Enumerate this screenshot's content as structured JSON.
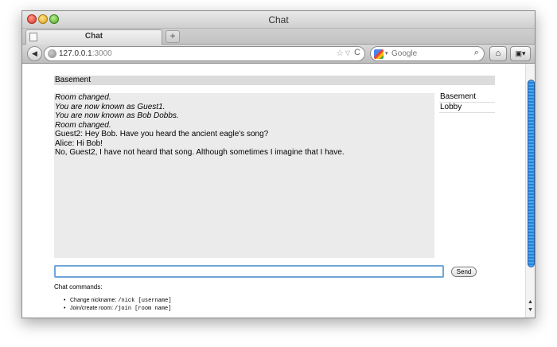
{
  "window": {
    "title": "Chat"
  },
  "tab": {
    "label": "Chat",
    "close": "×",
    "new_tab": "+"
  },
  "nav": {
    "back": "◀",
    "url_host": "127.0.0.1",
    "url_port": ":3000",
    "bookmark_star": "☆",
    "url_dropdown": "▽",
    "reload": "C",
    "search_placeholder": "Google",
    "search_dropdown": "▾",
    "search_glass": "⌕",
    "home": "⌂",
    "menu": "▣▾"
  },
  "page": {
    "room_header": "Basement",
    "messages": [
      {
        "text": "Room changed.",
        "system": true
      },
      {
        "text": "You are now known as Guest1.",
        "system": true
      },
      {
        "text": "You are now known as Bob Dobbs.",
        "system": true
      },
      {
        "text": "Room changed.",
        "system": true
      },
      {
        "text": "Guest2: Hey Bob. Have you heard the ancient eagle's song?",
        "system": false
      },
      {
        "text": "Alice: Hi Bob!",
        "system": false
      },
      {
        "text": "No, Guest2, I have not heard that song. Although sometimes I imagine that I have.",
        "system": false
      }
    ],
    "rooms": [
      "Basement",
      "Lobby"
    ],
    "send_input_value": "",
    "send_label": "Send",
    "commands_title": "Chat commands:",
    "commands": [
      {
        "label": "Change nickname: ",
        "code": "/nick [username]"
      },
      {
        "label": "Join/create room: ",
        "code": "/join [room name]"
      }
    ]
  },
  "scroll": {
    "up": "▲",
    "down": "▼",
    "position": 0.05
  }
}
